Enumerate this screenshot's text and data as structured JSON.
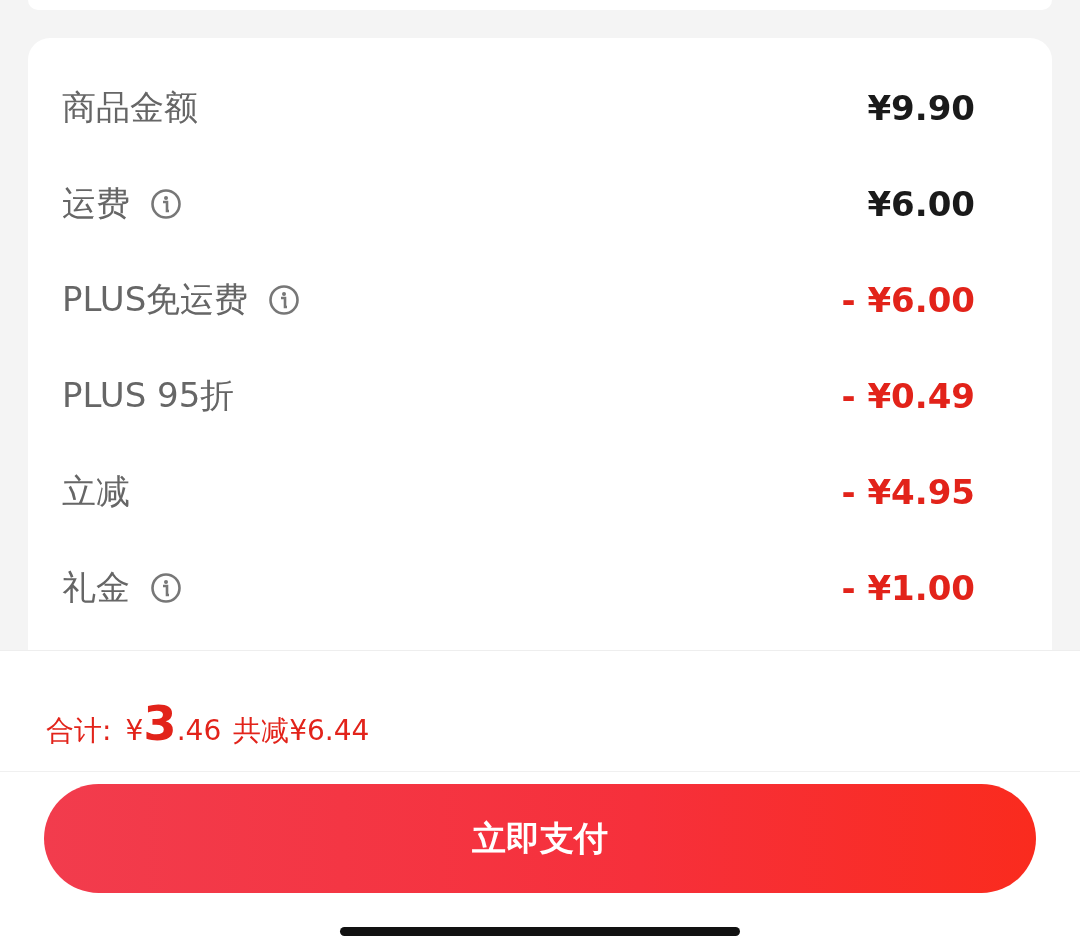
{
  "summary": {
    "rows": [
      {
        "label": "商品金额",
        "info": false,
        "kind": "charge",
        "amount": "¥9.90"
      },
      {
        "label": "运费",
        "info": true,
        "kind": "charge",
        "amount": "¥6.00"
      },
      {
        "label": "PLUS免运费",
        "info": true,
        "kind": "discount",
        "amount": "- ¥6.00"
      },
      {
        "label": "PLUS 95折",
        "info": false,
        "kind": "discount",
        "amount": "- ¥0.49"
      },
      {
        "label": "立减",
        "info": false,
        "kind": "discount",
        "amount": "- ¥4.95"
      },
      {
        "label": "礼金",
        "info": true,
        "kind": "discount",
        "amount": "- ¥1.00"
      }
    ]
  },
  "total": {
    "label": "合计:",
    "currency": "¥",
    "integer": "3",
    "decimal": ".46",
    "saving": "共减¥6.44"
  },
  "pay_button": {
    "label": "立即支付"
  }
}
